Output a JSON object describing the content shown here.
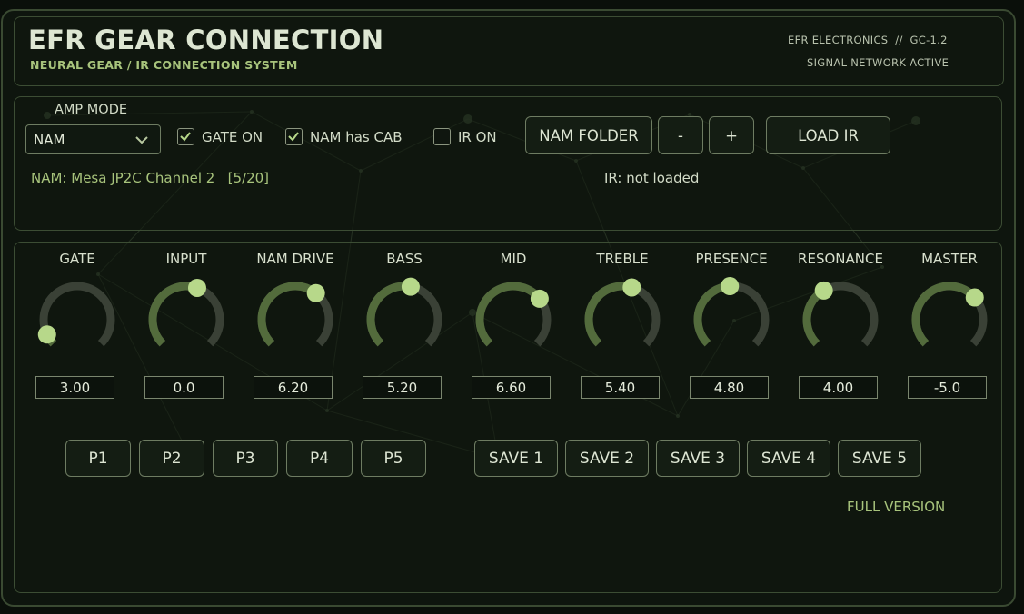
{
  "header": {
    "title": "EFR GEAR CONNECTION",
    "subtitle": "NEURAL GEAR / IR CONNECTION SYSTEM",
    "vendor": "EFR ELECTRONICS  //  GC-1.2",
    "network_status": "SIGNAL NETWORK ACTIVE"
  },
  "controls": {
    "amp_mode_label": "AMP MODE",
    "amp_mode_value": "NAM",
    "gate_on": {
      "label": "GATE ON",
      "checked": true
    },
    "nam_has_cab": {
      "label": "NAM has CAB",
      "checked": true
    },
    "ir_on": {
      "label": "IR ON",
      "checked": false
    },
    "nam_folder_label": "NAM FOLDER",
    "minus_label": "-",
    "plus_label": "+",
    "load_ir_label": "LOAD IR",
    "nam_status": "NAM: Mesa JP2C Channel 2   [5/20]",
    "ir_status": "IR: not loaded"
  },
  "knobs": [
    {
      "id": "gate",
      "label": "GATE",
      "value": "3.00",
      "level": 0.07
    },
    {
      "id": "input",
      "label": "INPUT",
      "value": "0.0",
      "level": 0.57
    },
    {
      "id": "nam-drive",
      "label": "NAM DRIVE",
      "value": "6.20",
      "level": 0.64
    },
    {
      "id": "bass",
      "label": "BASS",
      "value": "5.20",
      "level": 0.54
    },
    {
      "id": "mid",
      "label": "MID",
      "value": "6.60",
      "level": 0.69
    },
    {
      "id": "treble",
      "label": "TREBLE",
      "value": "5.40",
      "level": 0.56
    },
    {
      "id": "presence",
      "label": "PRESENCE",
      "value": "4.80",
      "level": 0.49
    },
    {
      "id": "resonance",
      "label": "RESONANCE",
      "value": "4.00",
      "level": 0.39
    },
    {
      "id": "master",
      "label": "MASTER",
      "value": "-5.0",
      "level": 0.68
    }
  ],
  "presets": [
    "P1",
    "P2",
    "P3",
    "P4",
    "P5"
  ],
  "saves": [
    "SAVE 1",
    "SAVE 2",
    "SAVE 3",
    "SAVE 4",
    "SAVE 5"
  ],
  "footer": {
    "full_version": "FULL VERSION"
  },
  "colors": {
    "accent": "#a8c47c",
    "knob_track": "#3a4136",
    "knob_fill": "#536b3c",
    "knob_handle": "#b7d88a"
  }
}
